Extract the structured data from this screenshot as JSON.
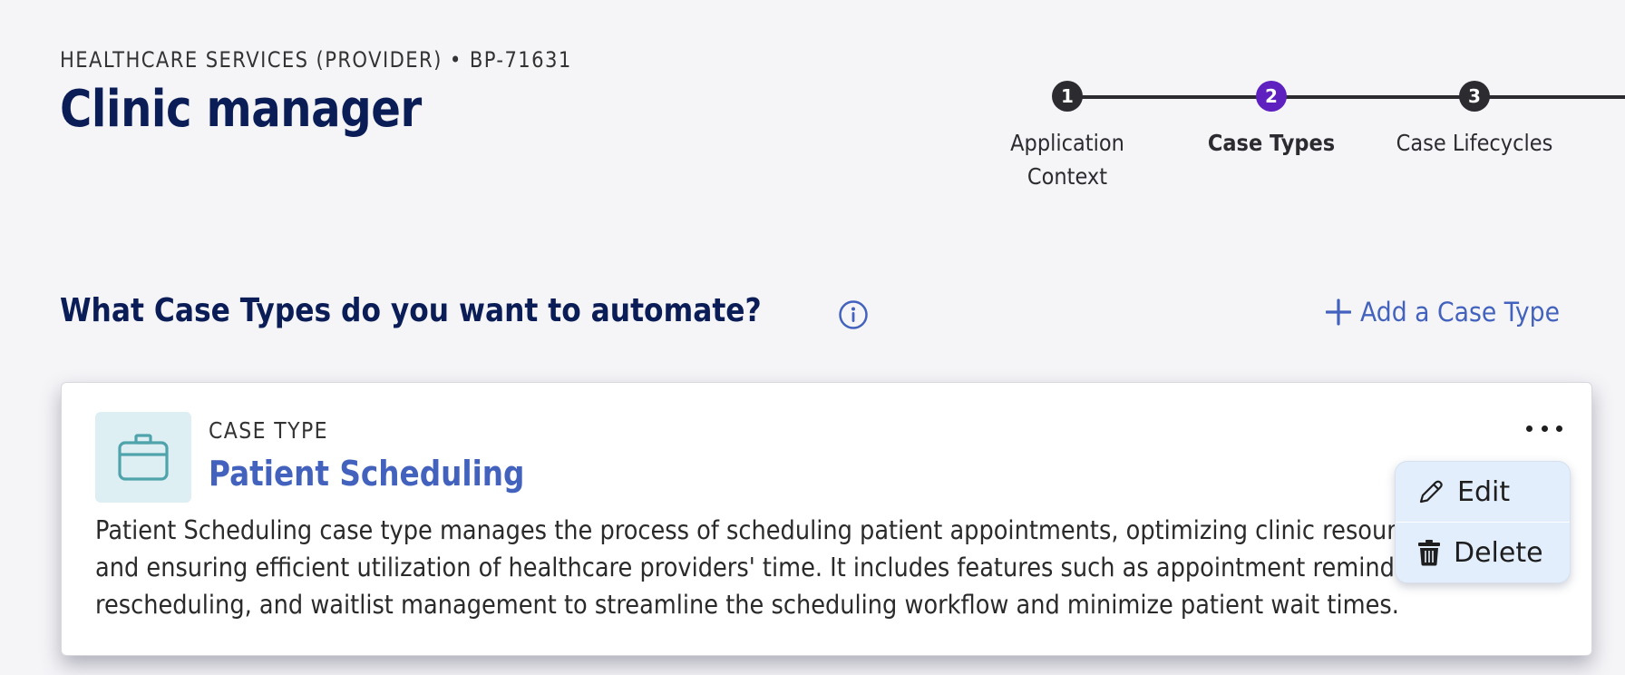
{
  "header": {
    "eyebrow": "HEALTHCARE SERVICES (PROVIDER) • BP-71631",
    "title": "Clinic manager"
  },
  "stepper": {
    "steps": [
      {
        "number": "1",
        "label_line1": "Application",
        "label_line2": "Context",
        "state": "complete"
      },
      {
        "number": "2",
        "label_line1": "Case Types",
        "label_line2": "",
        "state": "active"
      },
      {
        "number": "3",
        "label_line1": "Case Lifecycles",
        "label_line2": "",
        "state": "upcoming"
      }
    ],
    "colors": {
      "default": "#2b2b30",
      "active": "#5e21c0"
    }
  },
  "section": {
    "title": "What Case Types do you want to automate?",
    "info_icon": "info-circle-icon",
    "add_button_label": "Add a Case Type",
    "add_icon": "plus-icon"
  },
  "case_types": [
    {
      "icon": "briefcase-icon",
      "kicker": "CASE TYPE",
      "name": "Patient Scheduling",
      "description": "Patient Scheduling case type manages the process of scheduling patient appointments, optimizing clinic resources and ensuring efficient utilization of healthcare providers' time. It includes features such as appointment reminders, rescheduling, and waitlist management to streamline the scheduling workflow and minimize patient wait times.",
      "more_icon": "more-horizontal-icon"
    }
  ],
  "context_menu": {
    "items": [
      {
        "label": "Edit",
        "icon": "pencil-icon"
      },
      {
        "label": "Delete",
        "icon": "trash-icon"
      }
    ]
  },
  "colors": {
    "heading": "#0b1d57",
    "accent": "#4262bd",
    "icon_teal": "#4fa3ab",
    "icon_tile_bg": "#ddeff3",
    "menu_bg": "#e3eefc",
    "background": "#f5f5f8"
  }
}
